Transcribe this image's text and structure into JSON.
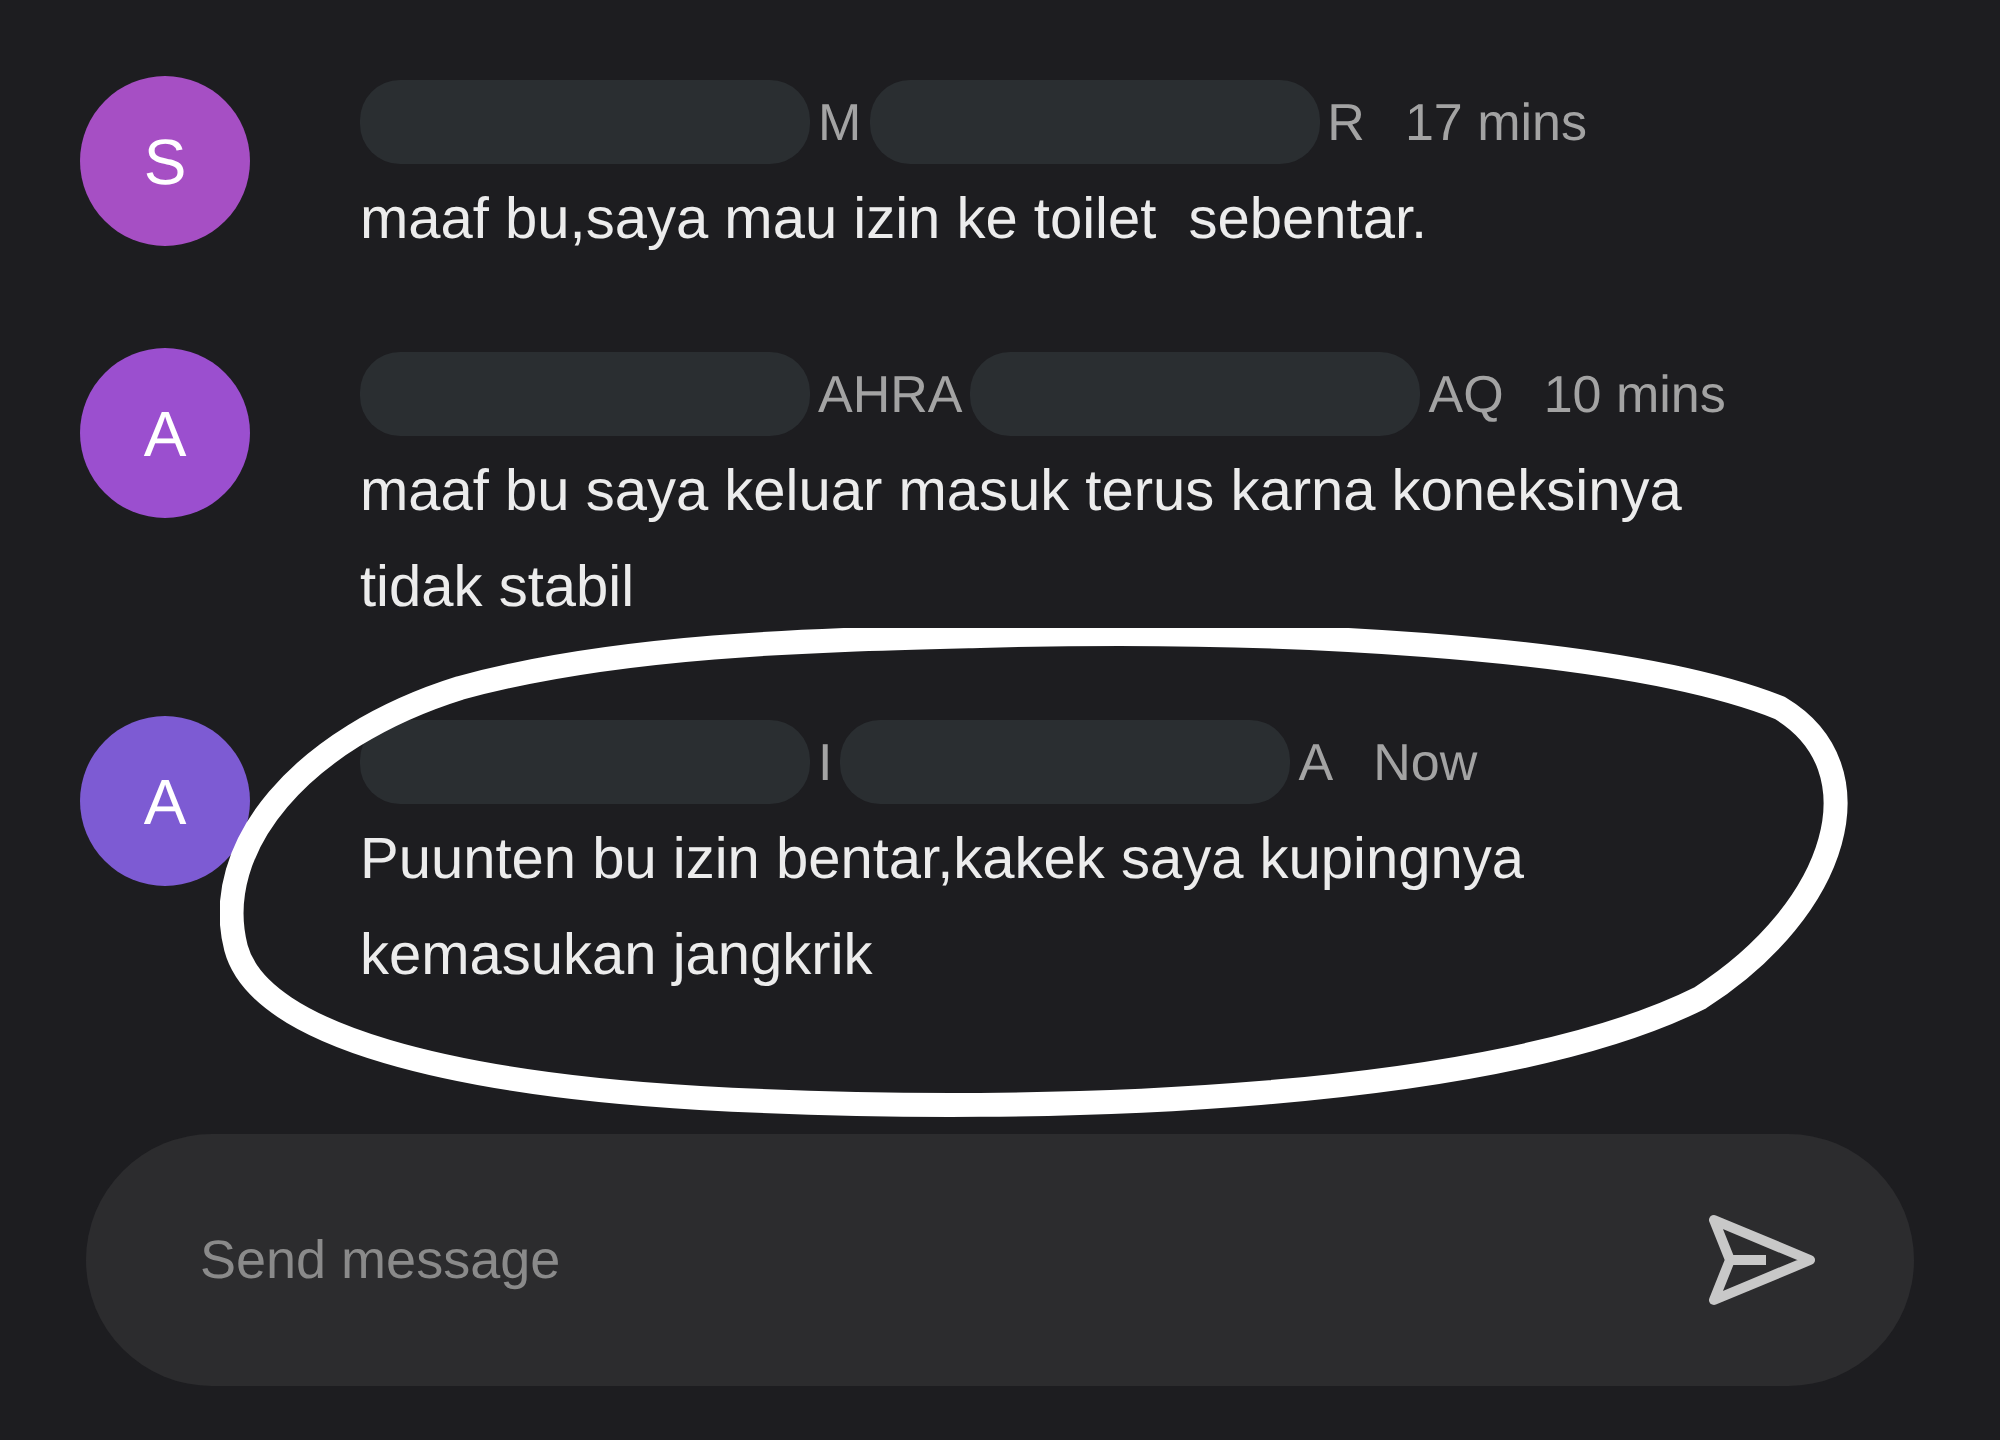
{
  "messages": [
    {
      "avatar_letter": "S",
      "color": "#a64fc4",
      "circled": false,
      "sender_parts": [
        {
          "kind": "redacted"
        },
        {
          "kind": "text",
          "text": "M"
        },
        {
          "kind": "redacted"
        },
        {
          "kind": "text",
          "text": "R"
        }
      ],
      "time": "17 mins",
      "text": "maaf bu,saya mau izin ke toilet  sebentar."
    },
    {
      "avatar_letter": "A",
      "color": "#9b4fcf",
      "circled": false,
      "sender_parts": [
        {
          "kind": "redacted"
        },
        {
          "kind": "text",
          "text": "AHRA"
        },
        {
          "kind": "redacted"
        },
        {
          "kind": "text",
          "text": "AQ"
        }
      ],
      "time": "10 mins",
      "text": "maaf bu saya keluar masuk terus karna koneksinya tidak stabil"
    },
    {
      "avatar_letter": "A",
      "color": "#7d5bd3",
      "circled": true,
      "sender_parts": [
        {
          "kind": "redacted"
        },
        {
          "kind": "text",
          "text": "I"
        },
        {
          "kind": "redacted"
        },
        {
          "kind": "text",
          "text": "A"
        }
      ],
      "time": "Now",
      "text": "Puunten bu izin bentar,kakek saya kupingnya kemasukan jangkrik"
    }
  ],
  "composer": {
    "placeholder": "Send message"
  }
}
